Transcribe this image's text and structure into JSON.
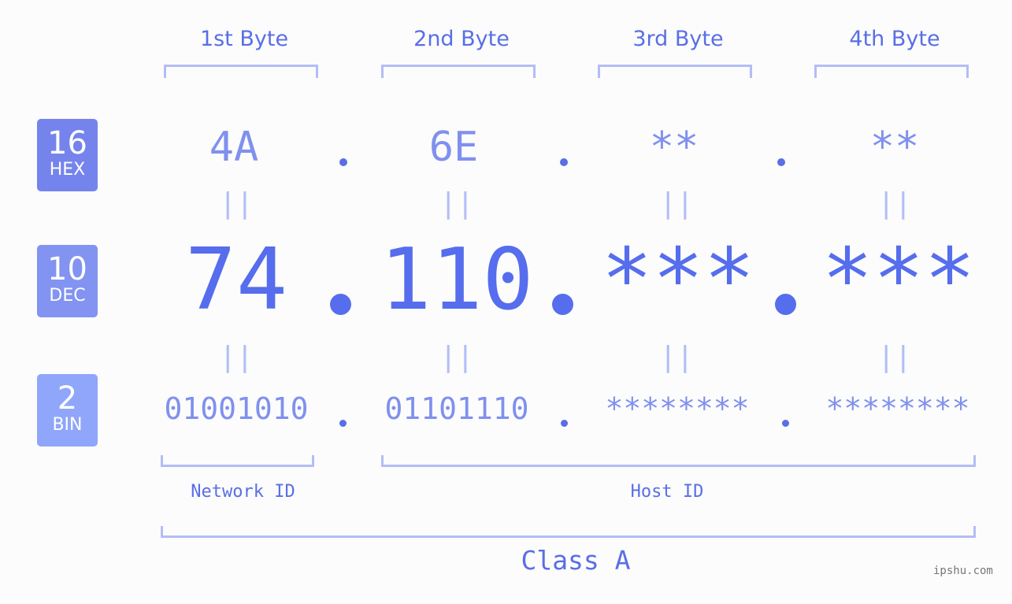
{
  "bytes": [
    {
      "label": "1st Byte",
      "hex": "4A",
      "dec": "74",
      "bin": "01001010"
    },
    {
      "label": "2nd Byte",
      "hex": "6E",
      "dec": "110",
      "bin": "01101110"
    },
    {
      "label": "3rd Byte",
      "hex": "**",
      "dec": "***",
      "bin": "********"
    },
    {
      "label": "4th Byte",
      "hex": "**",
      "dec": "***",
      "bin": "********"
    }
  ],
  "badges": {
    "hex": {
      "num": "16",
      "label": "HEX",
      "color": "#7584ec"
    },
    "dec": {
      "num": "10",
      "label": "DEC",
      "color": "#8293f1"
    },
    "bin": {
      "num": "2",
      "label": "BIN",
      "color": "#8fa6fa"
    }
  },
  "equals_glyph": "||",
  "segments": {
    "network": "Network ID",
    "host": "Host ID",
    "class": "Class A"
  },
  "watermark": "ipshu.com",
  "colors": {
    "accent": "#566ded",
    "light_accent": "#8090ee",
    "bracket": "#b3bdf6",
    "background": "#fbfcfb"
  }
}
